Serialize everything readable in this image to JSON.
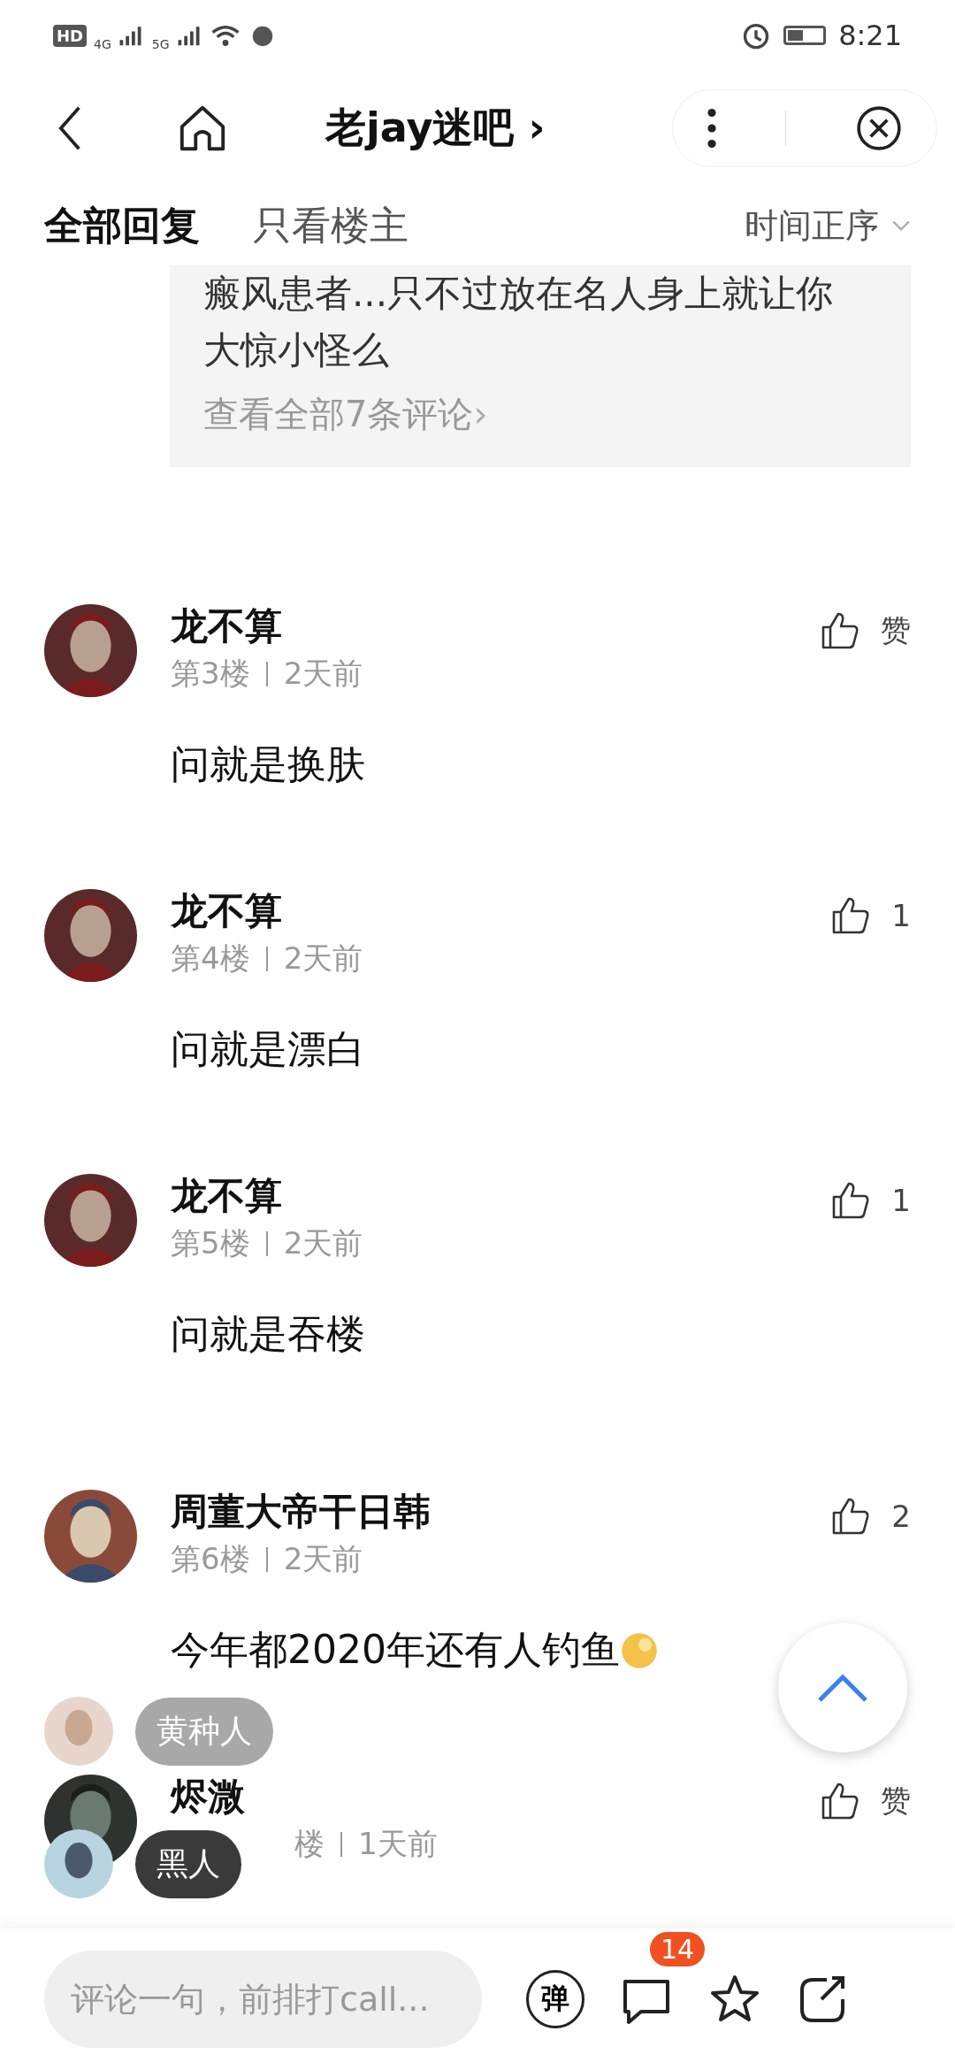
{
  "status_bar": {
    "hd": "HD",
    "network_4g": "4G",
    "network_5g": "5G",
    "time": "8:21"
  },
  "nav": {
    "title": "老jay迷吧",
    "title_arrow": "›"
  },
  "tabs": [
    {
      "label": "全部回复",
      "selected": true
    },
    {
      "label": "只看楼主",
      "selected": false
    }
  ],
  "sort": {
    "label": "时间正序"
  },
  "quoted_reply": {
    "lines": [
      "瘢风患者...只不过放在名人身上就让你",
      "大惊小怪么"
    ],
    "more_link": "查看全部7条评论",
    "more_arrow": "›"
  },
  "comments": [
    {
      "name": "龙不算",
      "floor": "第3楼",
      "time": "2天前",
      "likes": "赞",
      "content": "问就是换肤"
    },
    {
      "name": "龙不算",
      "floor": "第4楼",
      "time": "2天前",
      "likes": "1",
      "content": "问就是漂白"
    },
    {
      "name": "龙不算",
      "floor": "第5楼",
      "time": "2天前",
      "likes": "1",
      "content": "问就是吞楼"
    },
    {
      "name": "周董大帝干日韩",
      "floor": "第6楼",
      "time": "2天前",
      "likes": "2",
      "content": "今年都2020年还有人钓鱼",
      "emoji": true
    },
    {
      "name": "烬溦",
      "floor": "楼",
      "time": "1天前",
      "likes": "赞"
    }
  ],
  "danmaku": [
    {
      "text": "黄种人",
      "kind": "light"
    },
    {
      "text": "黑人",
      "kind": "dark"
    }
  ],
  "bottom_bar": {
    "placeholder": "评论一句，前排打call...",
    "danmaku_button": "弹",
    "comment_count": "14"
  }
}
